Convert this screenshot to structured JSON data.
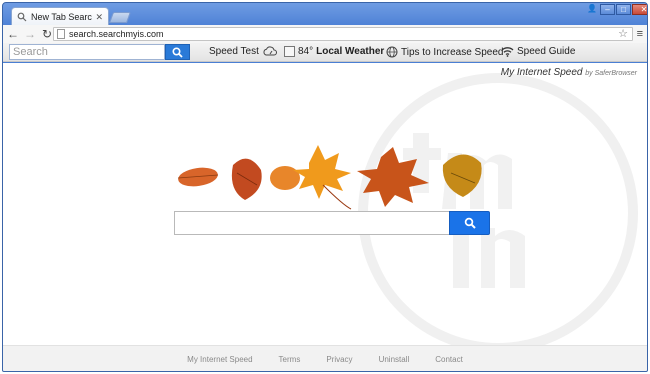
{
  "browser": {
    "tab_title": "New Tab Search",
    "url": "search.searchmyis.com",
    "window_controls": {
      "user": "👤",
      "minimize": "–",
      "maximize": "□",
      "close": "✕"
    }
  },
  "extension_bar": {
    "search_placeholder": "Search",
    "speed_test_label": "Speed Test",
    "weather_temp": "84°",
    "weather_label": "Local Weather",
    "tips_label": "Tips to Increase Speed",
    "speed_guide_label": "Speed Guide"
  },
  "branding": {
    "product": "My Internet Speed",
    "by": "by SaferBrowser"
  },
  "footer": {
    "links": [
      "My Internet Speed",
      "Terms",
      "Privacy",
      "Uninstall",
      "Contact"
    ]
  },
  "colors": {
    "chrome_blue": "#4f82d6",
    "search_button": "#1a73e8",
    "ext_search_button": "#2a7ad8"
  },
  "icons": {
    "search": "search-icon",
    "reload": "reload-icon",
    "back": "back-arrow-icon",
    "forward": "forward-arrow-icon",
    "star": "star-icon",
    "menu": "menu-icon",
    "speedtest": "cloud-speed-icon",
    "weather": "weather-icon",
    "globe": "globe-icon",
    "wifi": "wifi-icon"
  }
}
